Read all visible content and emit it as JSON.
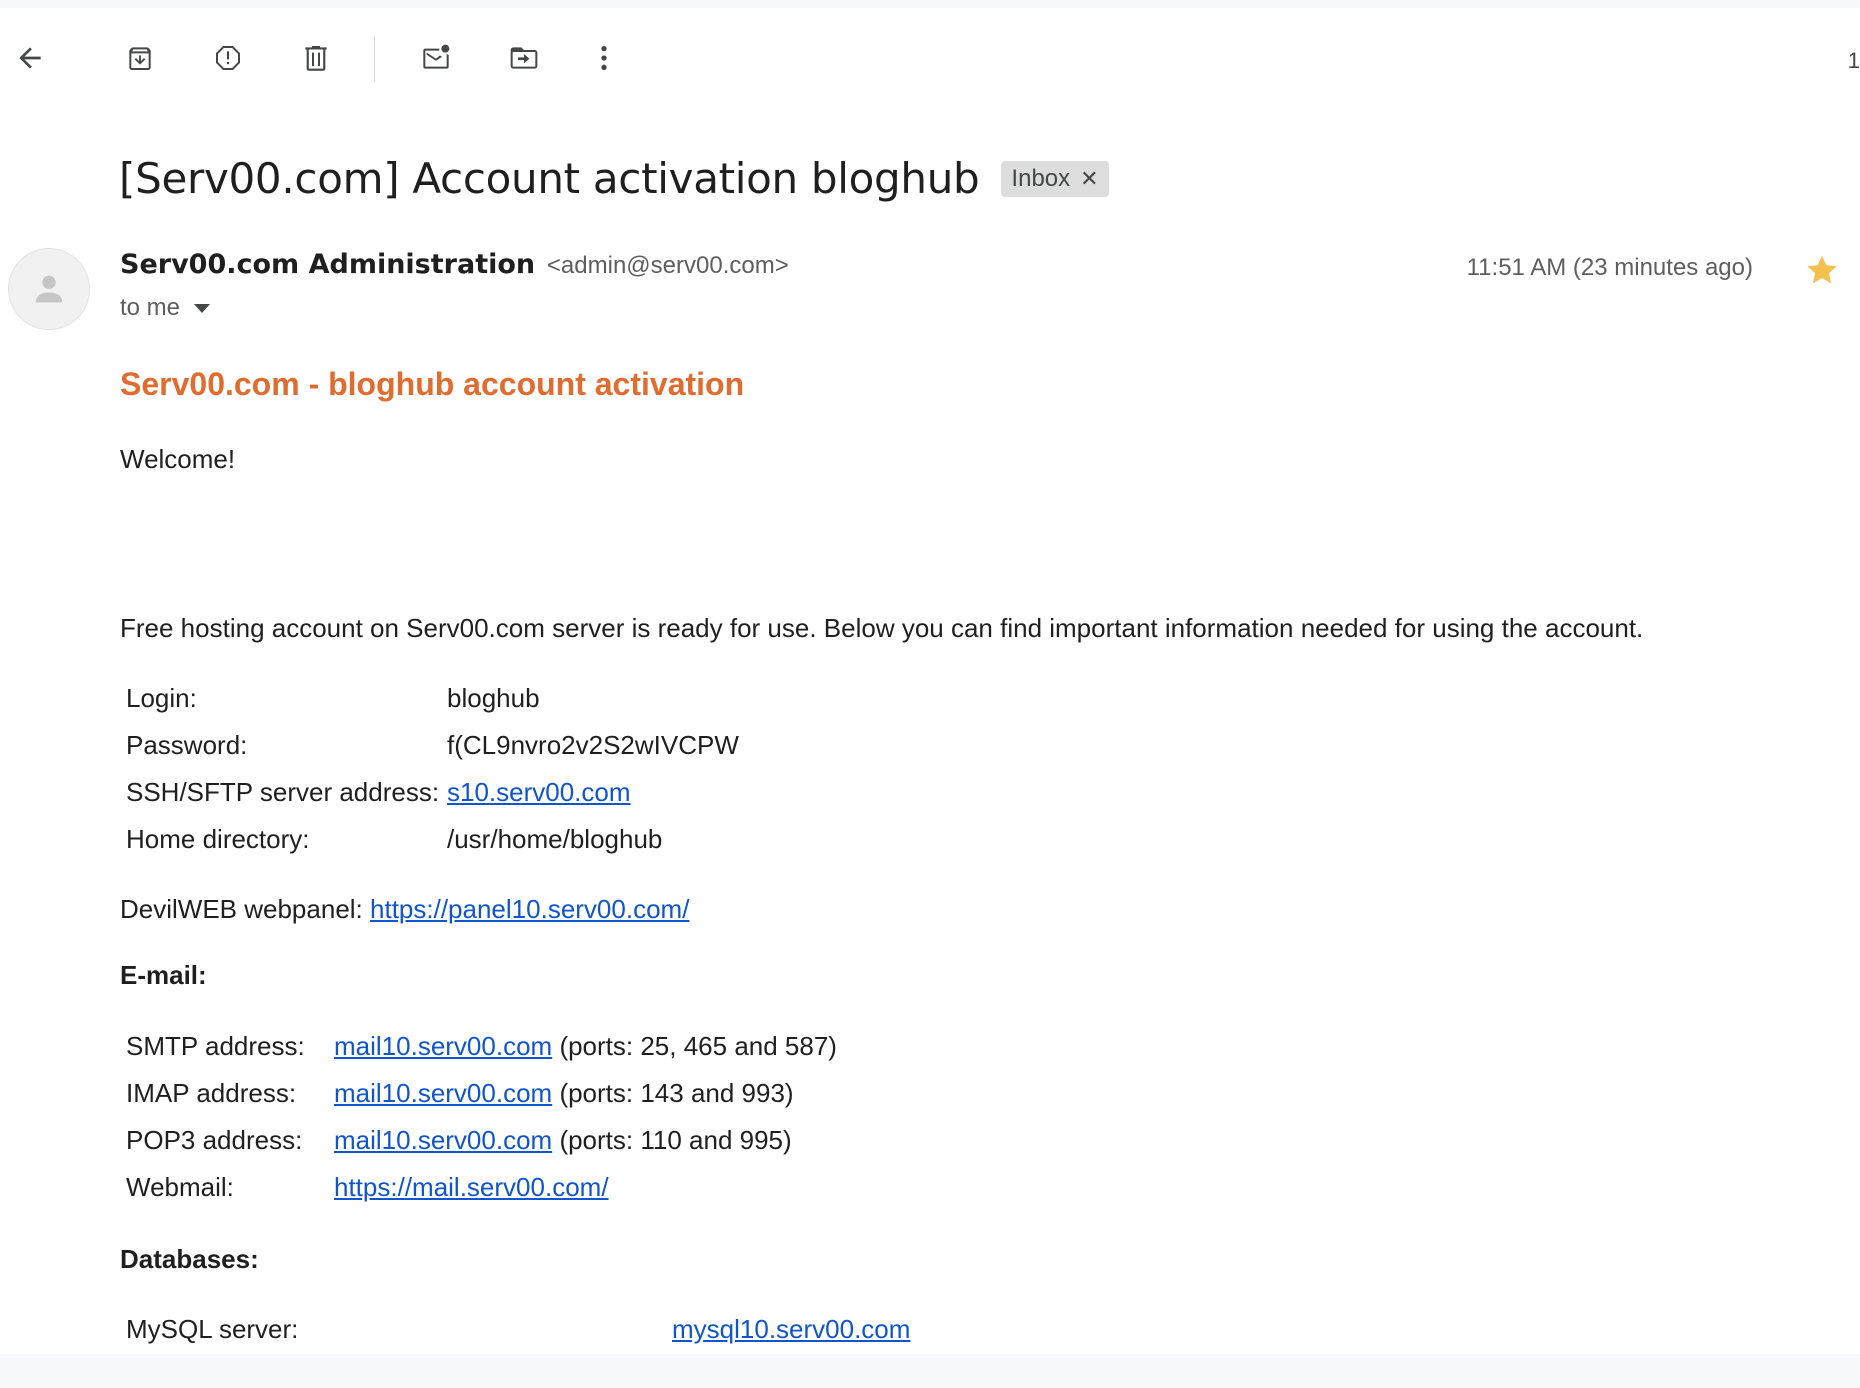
{
  "toolbar": {
    "back_icon": "arrow-left-icon",
    "archive_icon": "archive-icon",
    "report_spam_icon": "report-spam-icon",
    "delete_icon": "trash-icon",
    "mark_unread_icon": "mark-unread-icon",
    "move_to_icon": "move-to-folder-icon",
    "more_icon": "more-vert-icon",
    "page_count": "1"
  },
  "message": {
    "subject": "[Serv00.com] Account activation bloghub",
    "label": "Inbox",
    "sender_name": "Serv00.com Administration",
    "sender_email": "<admin@serv00.com>",
    "recipient": "to me",
    "time": "11:51 AM (23 minutes ago)",
    "starred": true,
    "star_color": "#f4c04e"
  },
  "email_body": {
    "title": "Serv00.com - bloghub account activation",
    "title_color": "#e06c2f",
    "welcome": "Welcome!",
    "intro": "Free hosting account on Serv00.com server is ready for use. Below you can find important information needed for using the account.",
    "account": [
      {
        "label": "Login:",
        "value": "bloghub",
        "link": false
      },
      {
        "label": "Password:",
        "value": "f(CL9nvro2v2S2wIVCPW",
        "link": false
      },
      {
        "label": "SSH/SFTP server address:",
        "value": "s10.serv00.com",
        "link": true
      },
      {
        "label": "Home directory:",
        "value": "/usr/home/bloghub",
        "link": false
      }
    ],
    "webpanel_label": "DevilWEB webpanel:",
    "webpanel_url": "https://panel10.serv00.com/",
    "email_heading": "E-mail:",
    "email_rows": [
      {
        "label": "SMTP address:",
        "link": "mail10.serv00.com",
        "extra": "(ports: 25, 465 and 587)"
      },
      {
        "label": "IMAP address:",
        "link": "mail10.serv00.com",
        "extra": "(ports: 143 and 993)"
      },
      {
        "label": "POP3 address:",
        "link": "mail10.serv00.com",
        "extra": "(ports: 110 and 995)"
      },
      {
        "label": "Webmail:",
        "link": "https://mail.serv00.com/",
        "extra": ""
      }
    ],
    "db_heading": "Databases:",
    "db_rows": [
      {
        "label": "MySQL server:",
        "link": "mysql10.serv00.com"
      }
    ]
  }
}
